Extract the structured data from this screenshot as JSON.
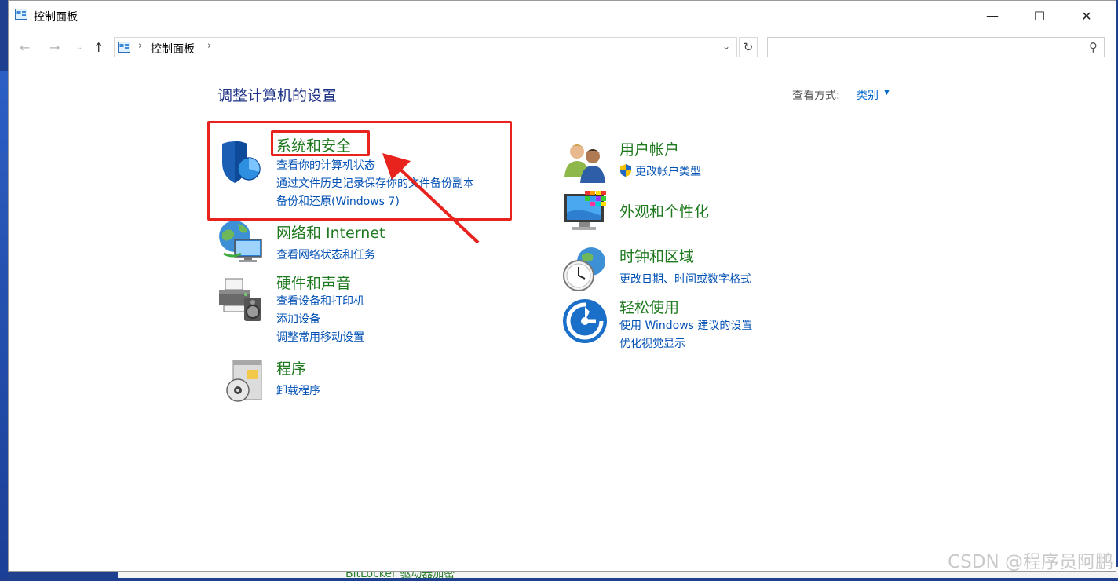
{
  "window": {
    "title": "控制面板"
  },
  "window_controls": {
    "minimize": "—",
    "maximize": "☐",
    "close": "✕"
  },
  "nav": {
    "back_icon": "arrow-left-icon",
    "forward_icon": "arrow-right-icon",
    "up_icon": "arrow-up-icon",
    "breadcrumb": "控制面板",
    "search_placeholder": ""
  },
  "main": {
    "title": "调整计算机的设置",
    "view_by_label": "查看方式:",
    "view_by_value": "类别"
  },
  "categories": [
    {
      "title": "系统和安全",
      "icon": "shield-icon",
      "links": [
        "查看你的计算机状态",
        "通过文件历史记录保存你的文件备份副本",
        "备份和还原(Windows 7)"
      ]
    },
    {
      "title": "网络和 Internet",
      "icon": "network-globe-icon",
      "links": [
        "查看网络状态和任务"
      ]
    },
    {
      "title": "硬件和声音",
      "icon": "printer-speaker-icon",
      "links": [
        "查看设备和打印机",
        "添加设备",
        "调整常用移动设置"
      ]
    },
    {
      "title": "程序",
      "icon": "programs-disc-icon",
      "links": [
        "卸载程序"
      ]
    },
    {
      "title": "用户帐户",
      "icon": "users-icon",
      "links": [
        "更改帐户类型"
      ]
    },
    {
      "title": "外观和个性化",
      "icon": "monitor-palette-icon",
      "links": []
    },
    {
      "title": "时钟和区域",
      "icon": "clock-globe-icon",
      "links": [
        "更改日期、时间或数字格式"
      ]
    },
    {
      "title": "轻松使用",
      "icon": "ease-of-access-icon",
      "links": [
        "使用 Windows 建议的设置",
        "优化视觉显示"
      ]
    }
  ],
  "desktop_behind": {
    "partial_text": "BitLocker 驱动器加密"
  },
  "watermark": "CSDN @程序员阿鹏",
  "colors": {
    "title_blue": "#1e3287",
    "category_green": "#1f7a1f",
    "link_blue": "#0050b4",
    "annotation_red": "#e8231e"
  }
}
